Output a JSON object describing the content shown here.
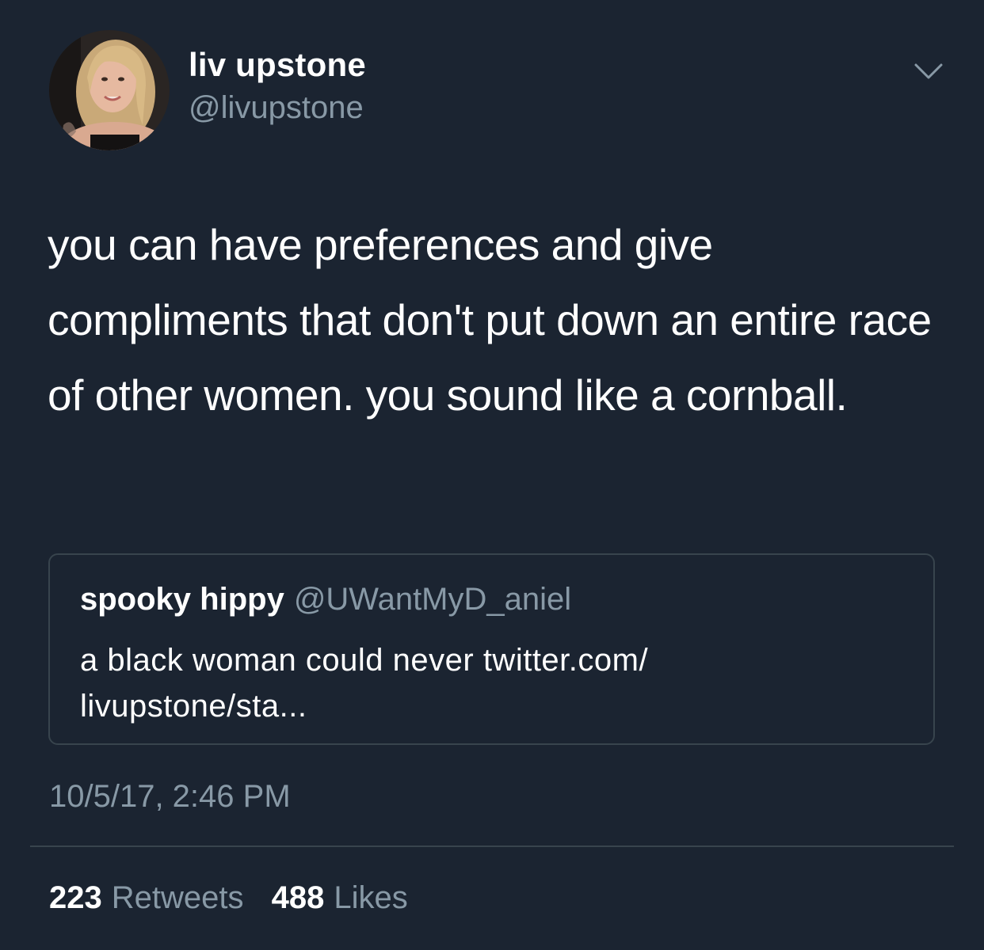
{
  "author": {
    "display_name": "liv upstone",
    "handle": "@livupstone"
  },
  "tweet": {
    "text": "you can have preferences and give compliments that don't put down an entire race of other women. you sound like a cornball.",
    "timestamp": "10/5/17, 2:46 PM"
  },
  "quoted_tweet": {
    "display_name": "spooky hippy",
    "handle": "@UWantMyD_aniel",
    "text_line1": "a black woman could never twitter.com/",
    "text_line2": "livupstone/sta..."
  },
  "stats": {
    "retweets_count": "223",
    "retweets_label": "Retweets",
    "likes_count": "488",
    "likes_label": "Likes"
  },
  "icons": {
    "menu": "chevron-down-icon"
  },
  "colors": {
    "background": "#1b2431",
    "secondary_text": "#8899a6",
    "border": "#38444d"
  }
}
